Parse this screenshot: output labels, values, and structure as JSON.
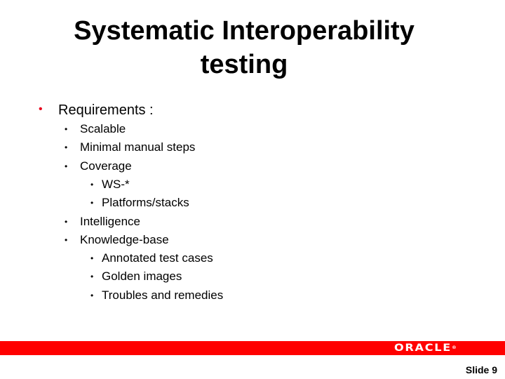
{
  "slide": {
    "title_lines": [
      "Systematic Interoperability",
      "testing"
    ],
    "bullets": [
      {
        "level": 1,
        "text": "Requirements :"
      },
      {
        "level": 2,
        "text": "Scalable"
      },
      {
        "level": 2,
        "text": "Minimal manual steps"
      },
      {
        "level": 2,
        "text": "Coverage"
      },
      {
        "level": 3,
        "text": "WS-*"
      },
      {
        "level": 3,
        "text": "Platforms/stacks"
      },
      {
        "level": 2,
        "text": "Intelligence"
      },
      {
        "level": 2,
        "text": "Knowledge-base"
      },
      {
        "level": 3,
        "text": "Annotated test cases"
      },
      {
        "level": 3,
        "text": "Golden images"
      },
      {
        "level": 3,
        "text": "Troubles and remedies"
      }
    ],
    "bullet_glyph": "•",
    "footer": {
      "logo_text": "ORACLE",
      "logo_mark": "®",
      "slide_number": "Slide 9"
    },
    "colors": {
      "accent_red": "#ff0000",
      "bullet_red": "#e8001c",
      "text": "#000000"
    }
  }
}
